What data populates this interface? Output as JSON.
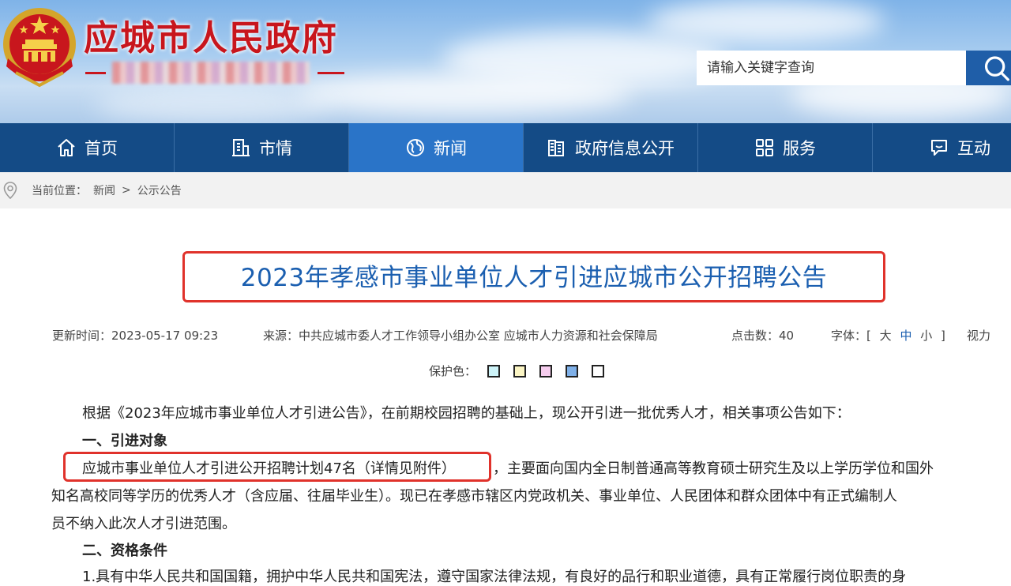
{
  "header": {
    "site_title": "应城市人民政府",
    "search_placeholder": "请输入关键字查询"
  },
  "nav": {
    "items": [
      {
        "label": "首页",
        "icon": "home-icon"
      },
      {
        "label": "市情",
        "icon": "building-icon"
      },
      {
        "label": "新闻",
        "icon": "globe-icon"
      },
      {
        "label": "政府信息公开",
        "icon": "document-icon"
      },
      {
        "label": "服务",
        "icon": "grid-icon"
      },
      {
        "label": "互动",
        "icon": "chat-icon"
      }
    ],
    "active": "新闻"
  },
  "breadcrumb": {
    "prefix": "当前位置：",
    "items": [
      "新闻",
      "公示公告"
    ],
    "separator": ">"
  },
  "article": {
    "title": "2023年孝感市事业单位人才引进应城市公开招聘公告",
    "meta": {
      "updated": "更新时间：2023-05-17 09:23",
      "source": "来源：中共应城市委人才工作领导小组办公室 应城市人力资源和社会保障局",
      "clicks": "点击数：40",
      "font_label": "字体：[",
      "font_large": "大",
      "font_medium": "中",
      "font_small": "小",
      "font_end": "]",
      "vision": "视力"
    },
    "protect_label": "保护色：",
    "protect_colors": [
      "#cdf3f8",
      "#fbf5c4",
      "#f6cdee",
      "#7fb0e8",
      "#ffffff"
    ],
    "paragraphs": {
      "p1": "根据《2023年应城市事业单位人才引进公告》，在前期校园招聘的基础上，现公开引进一批优秀人才，相关事项公告如下：",
      "h1": "一、引进对象",
      "p2_highlight": "应城市事业单位人才引进公开招聘计划47名（详情见附件）",
      "p2_rest": "，主要面向国内全日制普通高等教育硕士研究生及以上学历学位和国外",
      "p3": "知名高校同等学历的优秀人才（含应届、往届毕业生）。现已在孝感市辖区内党政机关、事业单位、人民团体和群众团体中有正式编制人",
      "p4": "员不纳入此次人才引进范围。",
      "h2": "二、资格条件",
      "p5": "1.具有中华人民共和国国籍，拥护中华人民共和国宪法，遵守国家法律法规，有良好的品行和职业道德，具有正常履行岗位职责的身"
    }
  }
}
